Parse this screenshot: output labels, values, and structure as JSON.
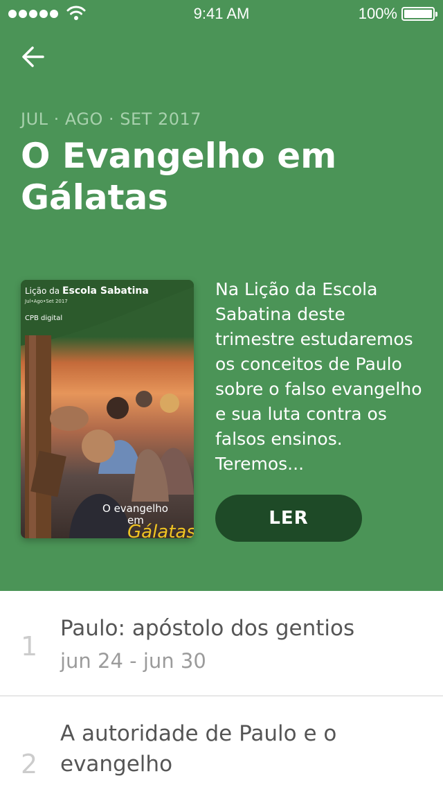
{
  "status_bar": {
    "time": "9:41 AM",
    "battery": "100%"
  },
  "header": {
    "quarter": "JUL · AGO · SET 2017",
    "title": "O Evangelho em Gálatas",
    "background_color": "#4b9457"
  },
  "cover": {
    "series_prefix": "Lição da",
    "series_name": "Escola Sabatina",
    "period": "Jul•Ago•Set 2017",
    "publisher": "CPB digital",
    "caption_line1": "O evangelho",
    "caption_line2": "em",
    "caption_highlight": "Gálatas"
  },
  "description": "Na Lição da Escola Sabatina deste trimestre estudaremos os conceitos de Paulo sobre o falso evangelho e sua luta contra os falsos ensinos. Teremos...",
  "read_button": {
    "label": "LER",
    "color": "#1e4a27"
  },
  "lessons": [
    {
      "number": "1",
      "title": "Paulo: apóstolo dos gentios",
      "dates": "jun 24 - jun 30"
    },
    {
      "number": "2",
      "title": "A autoridade de Paulo e o evangelho",
      "dates": ""
    }
  ]
}
